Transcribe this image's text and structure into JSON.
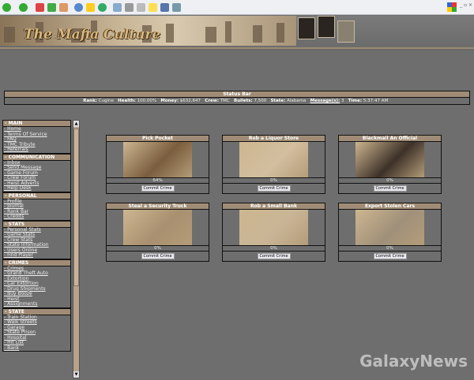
{
  "site": {
    "title": "The Mafia Culture",
    "watermark": "GalaxyNews"
  },
  "status": {
    "title": "Status Bar",
    "fields": [
      {
        "label": "Rank:",
        "value": "Cugine"
      },
      {
        "label": "Health:",
        "value": "100.00%"
      },
      {
        "label": "Money:",
        "value": "$632,647"
      },
      {
        "label": "Crew:",
        "value": "TMC"
      },
      {
        "label": "Bullets:",
        "value": "7,500"
      },
      {
        "label": "State:",
        "value": "Alabama"
      },
      {
        "label": "Message(s):",
        "value": "3"
      },
      {
        "label": "Time:",
        "value": "5:37:47 AM"
      }
    ]
  },
  "sidebar": [
    {
      "title": "- MAIN",
      "items": [
        "- Home",
        "- Terms Of Service",
        "- FAQ",
        "- TMC Tribute",
        "- Referrals"
      ]
    },
    {
      "title": "- COMMUNICATION",
      "items": [
        "- Inbox",
        "- Send Message",
        "- Game Forum",
        "- Crew Forum",
        "- Heist Adverts",
        "- Help Desk"
      ]
    },
    {
      "title": "- PERSONAL",
      "items": [
        "- Profile",
        "- Journal",
        "- Rank Bar",
        "- Credits"
      ]
    },
    {
      "title": "- STATS",
      "items": [
        "- Personal Stats",
        "- Game Stats",
        "- Crew Stats",
        "- State Information",
        "- Users Online",
        "- Find Player"
      ]
    },
    {
      "title": "- CRIMES",
      "items": [
        "- Crimes",
        "- Grand Theft Auto",
        "- Extortion",
        "- Car Extortion",
        "- Drug Shipments",
        "- Buy Booze",
        "- Heist",
        "- Assignments"
      ]
    },
    {
      "title": "- STATE",
      "items": [
        "- Train Station",
        "- Walk Streets",
        "- Garage",
        "- State Prison",
        "- Hospital",
        "- Hit List",
        "- Bank"
      ]
    }
  ],
  "crimes": [
    {
      "name": "Pick Pocket",
      "chance": "64%",
      "button": "Commit Crime"
    },
    {
      "name": "Rob a Liquor Store",
      "chance": "0%",
      "button": "Commit Crime"
    },
    {
      "name": "Blackmail An Official",
      "chance": "0%",
      "button": "Commit Crime"
    },
    {
      "name": "Steal a Security Truck",
      "chance": "0%",
      "button": "Commit Crime"
    },
    {
      "name": "Rob a Small Bank",
      "chance": "0%",
      "button": "Commit Crime"
    },
    {
      "name": "Export Stolen Cars",
      "chance": "0%",
      "button": "Commit Crime"
    }
  ],
  "colors": {
    "background": "#6e6e6e",
    "header_bar": "#a08c76"
  }
}
